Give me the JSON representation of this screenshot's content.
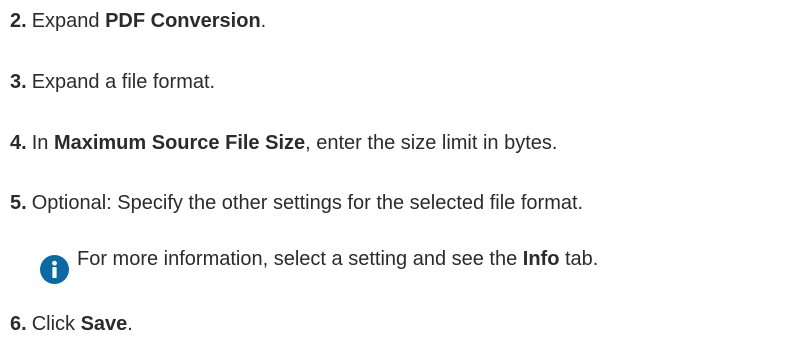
{
  "steps": [
    {
      "number": "2.",
      "parts": [
        {
          "text": "Expand ",
          "bold": false
        },
        {
          "text": "PDF Conversion",
          "bold": true
        },
        {
          "text": ".",
          "bold": false
        }
      ]
    },
    {
      "number": "3.",
      "parts": [
        {
          "text": "Expand a file format.",
          "bold": false
        }
      ]
    },
    {
      "number": "4.",
      "parts": [
        {
          "text": "In ",
          "bold": false
        },
        {
          "text": "Maximum Source File Size",
          "bold": true
        },
        {
          "text": ", enter the size limit in bytes.",
          "bold": false
        }
      ]
    },
    {
      "number": "5.",
      "parts": [
        {
          "text": "Optional: Specify the other settings for the selected file format.",
          "bold": false
        }
      ]
    },
    {
      "number": "6.",
      "parts": [
        {
          "text": "Click ",
          "bold": false
        },
        {
          "text": "Save",
          "bold": true
        },
        {
          "text": ".",
          "bold": false
        }
      ]
    }
  ],
  "note": {
    "icon": "info-icon",
    "icon_color": "#0b6aa3",
    "parts": [
      {
        "text": "For more information, select a setting and see the ",
        "bold": false
      },
      {
        "text": "Info",
        "bold": true
      },
      {
        "text": " tab.",
        "bold": false
      }
    ]
  }
}
